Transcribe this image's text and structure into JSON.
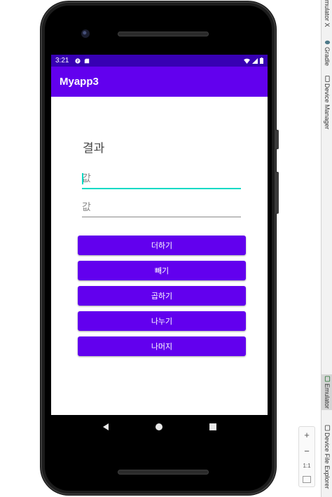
{
  "status_bar": {
    "time": "3:21"
  },
  "app": {
    "title": "Myapp3"
  },
  "main": {
    "result_label": "결과",
    "input1": {
      "value": "",
      "placeholder": "값"
    },
    "input2": {
      "value": "",
      "placeholder": "값"
    },
    "buttons": [
      {
        "label": "더하기"
      },
      {
        "label": "빼기"
      },
      {
        "label": "곱하기"
      },
      {
        "label": "나누기"
      },
      {
        "label": "나머지"
      }
    ]
  },
  "ide_tools": {
    "tabs": [
      {
        "label": "mulator X"
      },
      {
        "label": "Gradle",
        "icon": "elephant-icon"
      },
      {
        "label": "Device Manager",
        "icon": "device-manager-icon"
      },
      {
        "label": "Emulator",
        "icon": "emulator-icon",
        "active": true
      },
      {
        "label": "Device File Explorer",
        "icon": "file-explorer-icon"
      }
    ],
    "zoom": {
      "zoom_in": "+",
      "zoom_out": "−",
      "actual_size": "1:1"
    }
  },
  "colors": {
    "primary": "#6200ee",
    "primary_dark": "#3700b3",
    "accent": "#03dac5"
  }
}
